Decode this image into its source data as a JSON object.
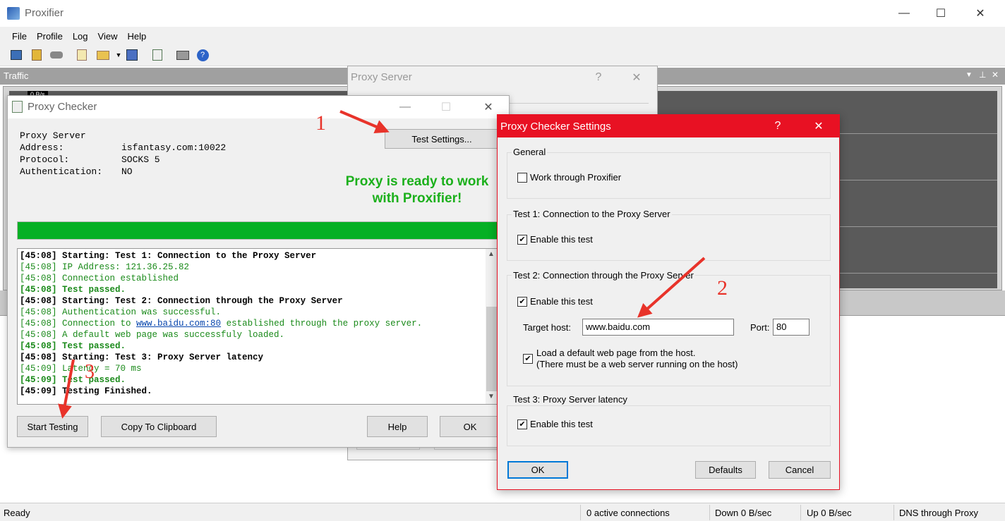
{
  "app": {
    "title": "Proxifier",
    "controls": {
      "minimize": "—",
      "maximize": "☐",
      "close": "✕"
    }
  },
  "menu": [
    "File",
    "Profile",
    "Log",
    "View",
    "Help"
  ],
  "toolbar_icons": [
    "proxy-servers-icon",
    "proxification-rules-icon",
    "name-resolution-icon",
    "new-profile-icon",
    "open-profile-icon",
    "dropdown-icon",
    "save-profile-icon",
    "check-proxy-icon",
    "print-icon",
    "help-icon"
  ],
  "traffic_panel": {
    "title": "Traffic",
    "partial_label": "0 B/s"
  },
  "proxy_server_dialog": {
    "title": "Proxy Server",
    "help": "?",
    "close": "✕"
  },
  "proxy_checker": {
    "title": "Proxy Checker",
    "info": [
      {
        "label": "Proxy Server",
        "value": ""
      },
      {
        "label": "Address:",
        "value": "isfantasy.com:10022"
      },
      {
        "label": "Protocol:",
        "value": "SOCKS 5"
      },
      {
        "label": "Authentication:",
        "value": "NO"
      }
    ],
    "test_settings_button": "Test Settings...",
    "status_line1": "Proxy is ready to work",
    "status_line2": "with Proxifier!",
    "progress": 1.0,
    "log": [
      {
        "text": "[45:08] Starting: Test 1: Connection to the Proxy Server",
        "style": "b"
      },
      {
        "text": "[45:08] IP Address: 121.36.25.82",
        "style": "g"
      },
      {
        "text": "[45:08] Connection established",
        "style": "g"
      },
      {
        "text": "[45:08] Test passed.",
        "style": "g b"
      },
      {
        "text": "[45:08] Starting: Test 2: Connection through the Proxy Server",
        "style": "b"
      },
      {
        "text": "[45:08] Authentication was successful.",
        "style": "g"
      },
      {
        "pre": "[45:08] Connection to ",
        "link": "www.baidu.com:80",
        "post": " established through the proxy server.",
        "style": "g"
      },
      {
        "text": "[45:08] A default web page was successfuly loaded.",
        "style": "g"
      },
      {
        "text": "[45:08] Test passed.",
        "style": "g b"
      },
      {
        "text": "[45:08] Starting: Test 3: Proxy Server latency",
        "style": "b"
      },
      {
        "text": "[45:09] Latency = 70 ms",
        "style": "g"
      },
      {
        "text": "[45:09] Test passed.",
        "style": "g b"
      },
      {
        "text": "[45:09] Testing Finished.",
        "style": "b"
      }
    ],
    "buttons": {
      "start": "Start Testing",
      "copy": "Copy To Clipboard",
      "help": "Help",
      "ok": "OK"
    }
  },
  "settings": {
    "title": "Proxy Checker Settings",
    "help": "?",
    "close": "✕",
    "general": {
      "title": "General",
      "work_through": "Work through Proxifier",
      "work_through_checked": false
    },
    "test1": {
      "title": "Test 1: Connection to the Proxy Server",
      "enable": "Enable this test",
      "checked": true
    },
    "test2": {
      "title": "Test 2: Connection through the Proxy Server",
      "enable": "Enable this test",
      "checked": true,
      "target_host_label": "Target host:",
      "target_host": "www.baidu.com",
      "port_label": "Port:",
      "port": "80",
      "load_line1": "Load a default web page from the host.",
      "load_line2": "(There must be a web server running on the host)",
      "load_checked": true
    },
    "test3": {
      "title": "Test 3: Proxy Server latency",
      "enable": "Enable this test",
      "checked": true
    },
    "buttons": {
      "ok": "OK",
      "defaults": "Defaults",
      "cancel": "Cancel"
    },
    "accent": "#e81123"
  },
  "annotations": [
    "1",
    "2",
    "3"
  ],
  "statusbar": {
    "ready": "Ready",
    "connections": "0 active connections",
    "down": "Down 0 B/sec",
    "up": "Up 0 B/sec",
    "dns": "DNS through Proxy"
  }
}
